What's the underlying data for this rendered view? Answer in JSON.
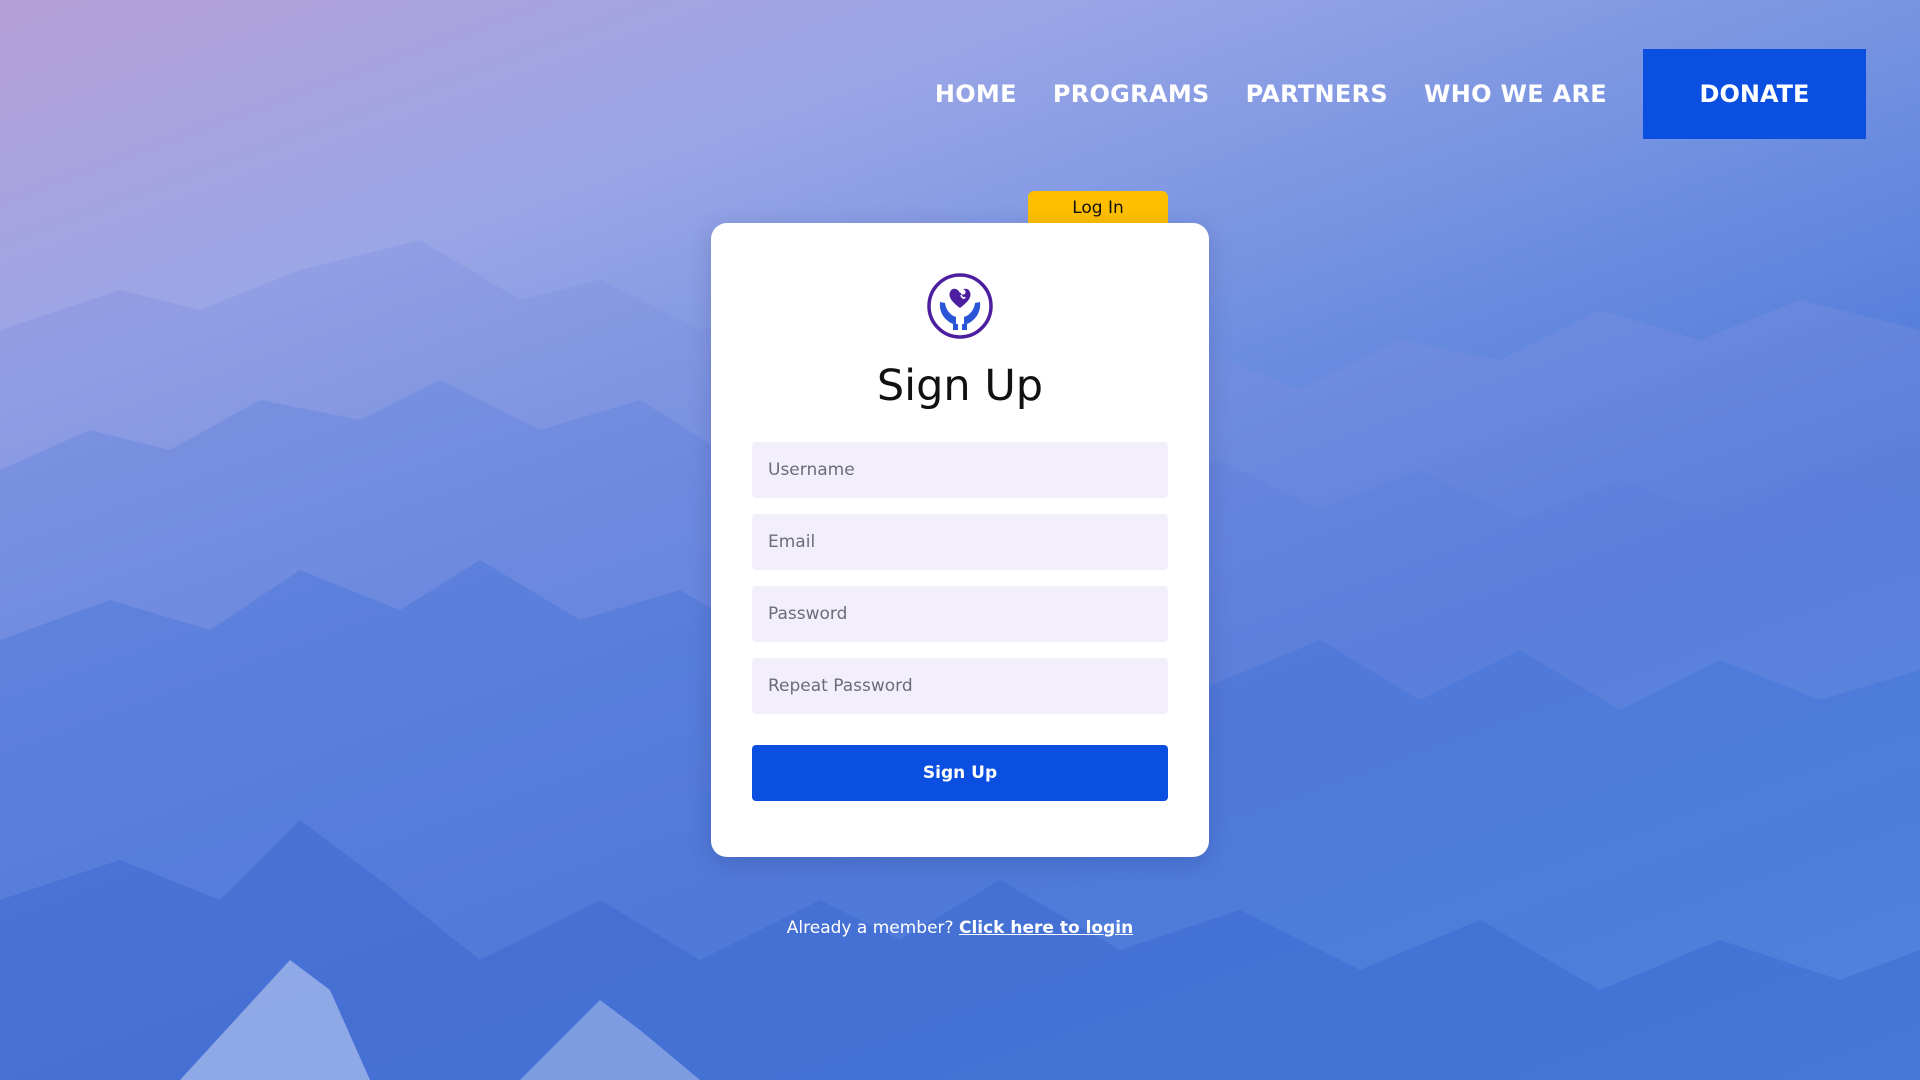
{
  "nav": {
    "items": [
      {
        "label": "HOME"
      },
      {
        "label": "PROGRAMS"
      },
      {
        "label": "PARTNERS"
      },
      {
        "label": "WHO WE ARE"
      }
    ],
    "donate_label": "DONATE"
  },
  "login_tab": {
    "label": "Log In"
  },
  "card": {
    "logo_icon": "heart-in-hands-icon",
    "title": "Sign Up",
    "fields": {
      "username": {
        "placeholder": "Username",
        "value": ""
      },
      "email": {
        "placeholder": "Email",
        "value": ""
      },
      "password": {
        "placeholder": "Password",
        "value": ""
      },
      "repeat_password": {
        "placeholder": "Repeat Password",
        "value": ""
      }
    },
    "submit_label": "Sign Up"
  },
  "footer": {
    "prompt": "Already a member?",
    "link_label": "Click here to login"
  },
  "colors": {
    "accent": "#0a4fe0",
    "tab": "#ffbf00",
    "field_bg": "#f2effa",
    "logo_purple": "#4b1fa0",
    "logo_blue": "#2a55d8"
  }
}
